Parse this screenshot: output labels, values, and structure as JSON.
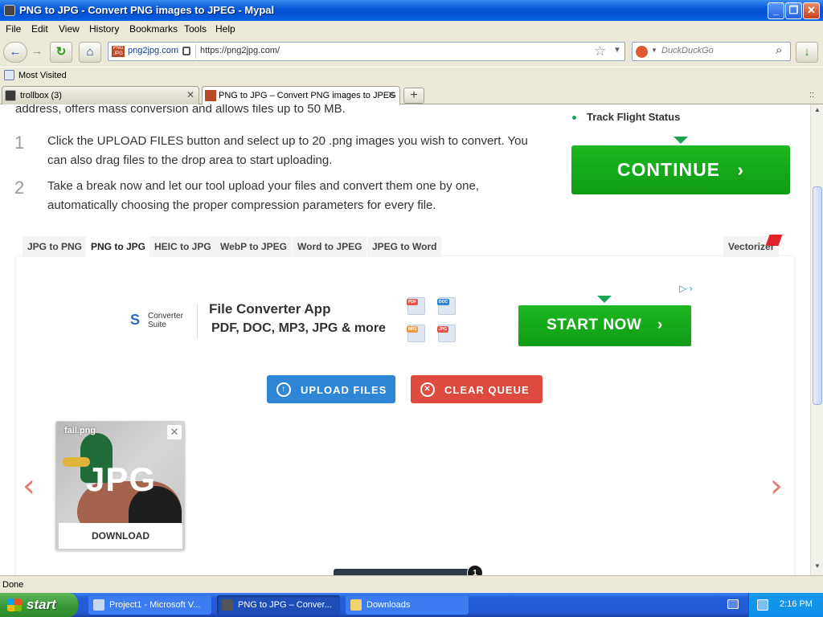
{
  "window": {
    "title": "PNG to JPG - Convert PNG images to JPEG - Mypal",
    "controls": {
      "minimize": "_",
      "maximize": "❐",
      "close": "✕"
    }
  },
  "menu": [
    "File",
    "Edit",
    "View",
    "History",
    "Bookmarks",
    "Tools",
    "Help"
  ],
  "nav": {
    "site_label": "png2jpg.com",
    "url": "https://png2jpg.com/",
    "search_placeholder": "DuckDuckGo",
    "icons": {
      "back": "←",
      "forward": "→",
      "reload": "↻",
      "home": "⌂",
      "star": "☆",
      "download": "↓",
      "search": "⌕"
    }
  },
  "bookmarks": {
    "most_visited": "Most Visited"
  },
  "tabs": [
    {
      "label": "trollbox (3)",
      "active": false
    },
    {
      "label": "PNG to JPG – Convert PNG images to JPEG",
      "active": true
    }
  ],
  "tab_bar": {
    "new_tab": "+",
    "tab_list": "::",
    "close": "✕"
  },
  "page": {
    "intro_tail": "address, offers mass conversion and allows files up to 50 MB.",
    "steps": [
      {
        "num": "1",
        "text": "Click the UPLOAD FILES button and select up to 20 .png images you wish to convert. You can also drag files to the drop area to start uploading."
      },
      {
        "num": "2",
        "text": "Take a break now and let our tool upload your files and convert them one by one, automatically choosing the proper compression parameters for every file."
      }
    ],
    "sidebar_bullet": "Track Flight Status",
    "continue_label": "CONTINUE",
    "continue_arrow": "›",
    "converter_tabs": [
      {
        "label": "JPG to PNG",
        "active": false
      },
      {
        "label": "PNG to JPG",
        "active": true
      },
      {
        "label": "HEIC to JPG",
        "active": false
      },
      {
        "label": "WebP to JPEG",
        "active": false
      },
      {
        "label": "Word to JPEG",
        "active": false
      },
      {
        "label": "JPEG to Word",
        "active": false
      }
    ],
    "vectorizer_label": "Vectorizer",
    "ad": {
      "brand_line1": "Converter",
      "brand_line2": "Suite",
      "title": "File Converter App",
      "subtitle": "PDF, DOC, MP3, JPG & more",
      "file_badges": [
        "PDF",
        "DOC",
        "MP3",
        "JPG"
      ],
      "cta_label": "START NOW",
      "cta_arrow": "›",
      "adchoices": "▷ ›"
    },
    "upload_label": "UPLOAD FILES",
    "upload_icon": "↑",
    "clear_label": "CLEAR QUEUE",
    "clear_icon": "✕",
    "prev_arrow": "‹",
    "next_arrow": "›",
    "file": {
      "name": "fail.png",
      "badge": "JPG",
      "download_label": "DOWNLOAD",
      "remove": "✕"
    },
    "queue_count": "1"
  },
  "status": {
    "text": "Done"
  },
  "taskbar": {
    "start_label": "start",
    "tasks": [
      {
        "label": "Project1 - Microsoft V...",
        "active": false
      },
      {
        "label": "PNG to JPG – Conver...",
        "active": true
      },
      {
        "label": "Downloads",
        "active": false
      }
    ],
    "clock": "2:16 PM"
  },
  "colors": {
    "green_button": "#1aa354",
    "upload_blue": "#2f86d6",
    "clear_red": "#df4a3e",
    "xp_blue": "#245edb"
  }
}
